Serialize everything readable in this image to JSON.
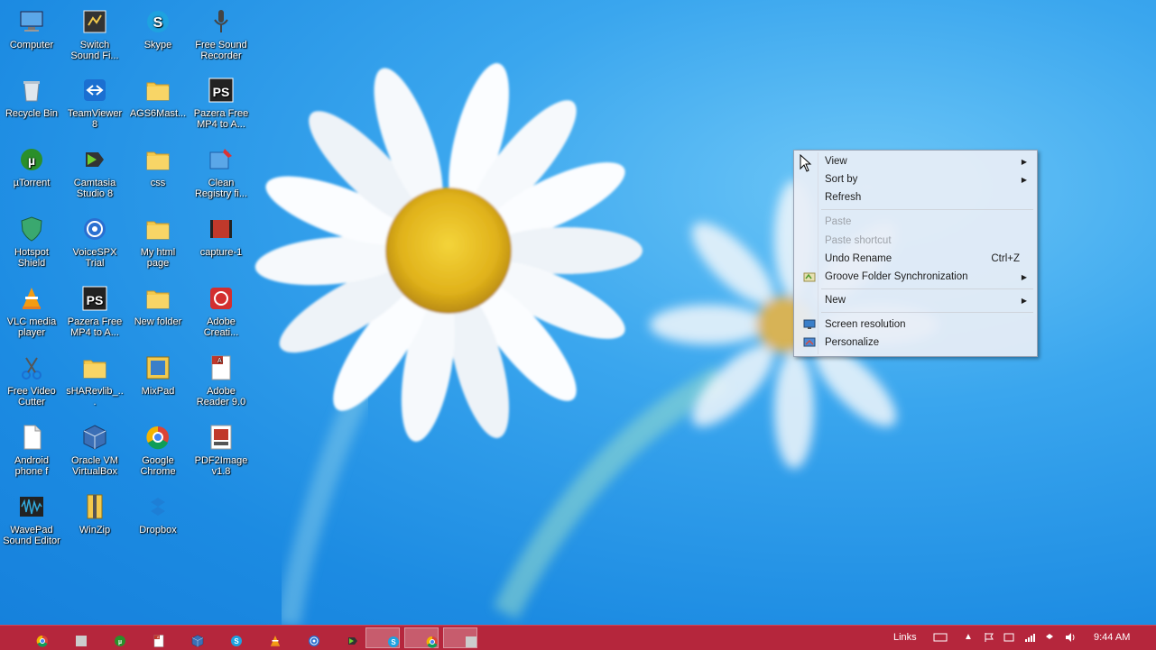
{
  "desktop": {
    "icons": [
      {
        "label": "Computer",
        "icon": "computer-icon"
      },
      {
        "label": "Switch Sound Fi...",
        "icon": "switch-sound-icon"
      },
      {
        "label": "Skype",
        "icon": "skype-icon"
      },
      {
        "label": "Free Sound Recorder",
        "icon": "microphone-icon"
      },
      {
        "label": "Recycle Bin",
        "icon": "recycle-bin-icon"
      },
      {
        "label": "TeamViewer 8",
        "icon": "teamviewer-icon"
      },
      {
        "label": "AGS6Mast...",
        "icon": "folder-icon"
      },
      {
        "label": "Pazera Free MP4 to A...",
        "icon": "pazera-icon"
      },
      {
        "label": "µTorrent",
        "icon": "utorrent-icon"
      },
      {
        "label": "Camtasia Studio 8",
        "icon": "camtasia-icon"
      },
      {
        "label": "css",
        "icon": "folder-icon"
      },
      {
        "label": "Clean Registry fi...",
        "icon": "registry-icon"
      },
      {
        "label": "Hotspot Shield",
        "icon": "hotspot-shield-icon"
      },
      {
        "label": "VoiceSPX Trial",
        "icon": "voicespx-icon"
      },
      {
        "label": "My html page",
        "icon": "folder-icon"
      },
      {
        "label": "capture-1",
        "icon": "video-file-icon"
      },
      {
        "label": "VLC media player",
        "icon": "vlc-icon"
      },
      {
        "label": "Pazera Free MP4 to A...",
        "icon": "pazera-icon"
      },
      {
        "label": "New folder",
        "icon": "folder-icon"
      },
      {
        "label": "Adobe Creati...",
        "icon": "adobe-creative-icon"
      },
      {
        "label": "Free Video Cutter",
        "icon": "scissors-icon"
      },
      {
        "label": "sHARevlib_...",
        "icon": "folder-icon"
      },
      {
        "label": "MixPad",
        "icon": "mixpad-icon"
      },
      {
        "label": "Adobe Reader 9.0",
        "icon": "adobe-reader-icon"
      },
      {
        "label": "Android phone f",
        "icon": "document-icon"
      },
      {
        "label": "Oracle VM VirtualBox",
        "icon": "virtualbox-icon"
      },
      {
        "label": "Google Chrome",
        "icon": "chrome-icon"
      },
      {
        "label": "PDF2Image v1.8",
        "icon": "pdf2image-icon"
      },
      {
        "label": "WavePad Sound Editor",
        "icon": "wavepad-icon"
      },
      {
        "label": "WinZip",
        "icon": "winzip-icon"
      },
      {
        "label": "Dropbox",
        "icon": "dropbox-icon"
      }
    ]
  },
  "context_menu": {
    "view": "View",
    "sort_by": "Sort by",
    "refresh": "Refresh",
    "paste": "Paste",
    "paste_shortcut": "Paste shortcut",
    "undo_rename": "Undo Rename",
    "undo_shortcut": "Ctrl+Z",
    "groove": "Groove Folder Synchronization",
    "new": "New",
    "screen_resolution": "Screen resolution",
    "personalize": "Personalize"
  },
  "taskbar": {
    "links": "Links",
    "time": "9:44 AM",
    "items": [
      "chrome-icon",
      "grid-app-icon",
      "utorrent-icon",
      "adobe-reader-icon",
      "virtualbox-icon",
      "skype-icon",
      "vlc-icon",
      "voicespx-icon",
      "camtasia-icon",
      "skype-icon",
      "chrome-icon",
      "camtasia-recorder-icon"
    ]
  },
  "colors": {
    "taskbar": "#b5263c",
    "wallpaper": "#2f97e6"
  }
}
